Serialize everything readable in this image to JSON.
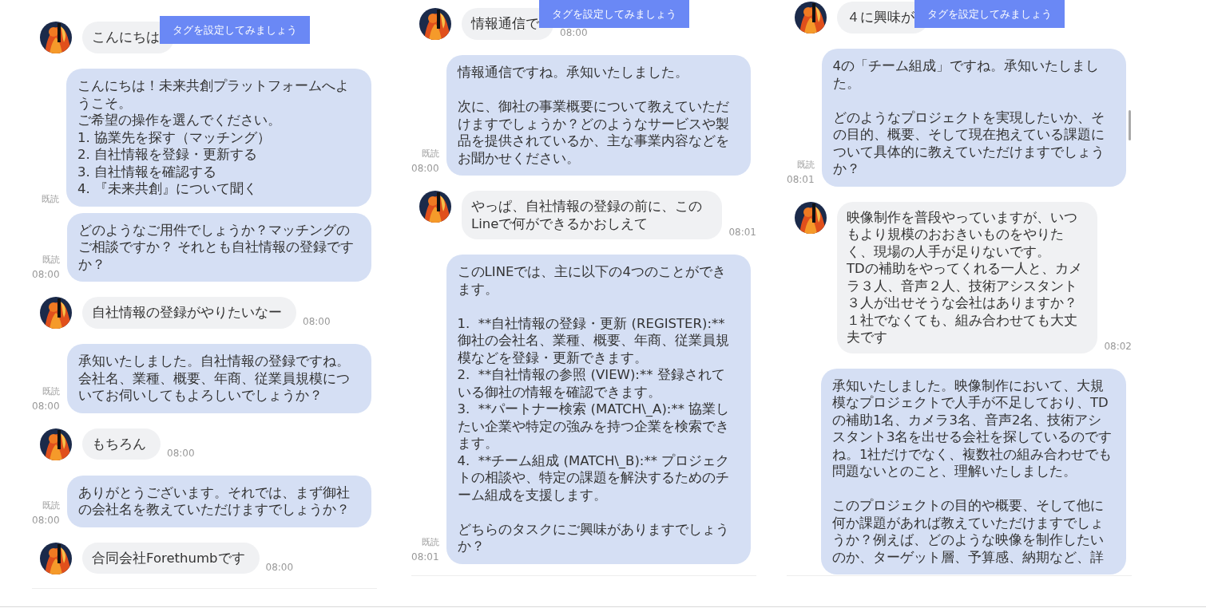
{
  "panels": [
    {
      "tag_banner": "タグを設定してみましょう",
      "scrollbar": false,
      "messages": [
        {
          "kind": "user",
          "paragraphs": [
            [
              "こんにちは"
            ]
          ]
        },
        {
          "kind": "bot",
          "paragraphs": [
            [
              "こんにちは！未来共創プラットフォームへようこそ。",
              "ご希望の操作を選んでください。",
              "1. 協業先を探す（マッチング）",
              "2. 自社情報を登録・更新する",
              "3. 自社情報を確認する",
              "4. 『未来共創』について聞く"
            ]
          ],
          "status": "既読"
        },
        {
          "kind": "bot",
          "paragraphs": [
            [
              "どのようなご用件でしょうか？マッチングのご相談ですか？ それとも自社情報の登録ですか？"
            ]
          ],
          "status": "既読",
          "time": "08:00"
        },
        {
          "kind": "user",
          "paragraphs": [
            [
              "自社情報の登録がやりたいなー"
            ]
          ],
          "time": "08:00"
        },
        {
          "kind": "bot",
          "paragraphs": [
            [
              "承知いたしました。自社情報の登録ですね。会社名、業種、概要、年商、従業員規模についてお伺いしてもよろしいでしょうか？"
            ]
          ],
          "status": "既読",
          "time": "08:00"
        },
        {
          "kind": "user",
          "paragraphs": [
            [
              "もちろん"
            ]
          ],
          "time": "08:00"
        },
        {
          "kind": "bot",
          "paragraphs": [
            [
              "ありがとうございます。それでは、まず御社の会社名を教えていただけますでしょうか？"
            ]
          ],
          "status": "既読",
          "time": "08:00"
        },
        {
          "kind": "user",
          "paragraphs": [
            [
              "合同会社Forethumbです"
            ]
          ],
          "time": "08:00"
        }
      ]
    },
    {
      "tag_banner": "タグを設定してみましょう",
      "scrollbar": false,
      "messages": [
        {
          "kind": "user",
          "paragraphs": [
            [
              "情報通信で"
            ]
          ],
          "time": "08:00"
        },
        {
          "kind": "bot",
          "paragraphs": [
            [
              "情報通信ですね。承知いたしました。"
            ],
            [
              "次に、御社の事業概要について教えていただけますでしょうか？どのようなサービスや製品を提供されているか、主な事業内容などをお聞かせください。"
            ]
          ],
          "status": "既読",
          "time": "08:00"
        },
        {
          "kind": "user",
          "paragraphs": [
            [
              "やっぱ、自社情報の登録の前に、このLineで何ができるかおしえて"
            ]
          ],
          "time": "08:01"
        },
        {
          "kind": "bot",
          "paragraphs": [
            [
              "このLINEでは、主に以下の4つのことができます。"
            ],
            [
              "1.  **自社情報の登録・更新 (REGISTER):** 御社の会社名、業種、概要、年商、従業員規模などを登録・更新できます。",
              "2.  **自社情報の参照 (VIEW):** 登録されている御社の情報を確認できます。",
              "3.  **パートナー検索 (MATCH\\_A):** 協業したい企業や特定の強みを持つ企業を検索できます。",
              "4.  **チーム組成 (MATCH\\_B):** プロジェクトの相談や、特定の課題を解決するためのチーム組成を支援します。"
            ],
            [
              "どちらのタスクにご興味がありますでしょうか？"
            ]
          ],
          "status": "既読",
          "time": "08:01"
        }
      ]
    },
    {
      "tag_banner": "タグを設定してみましょう",
      "scrollbar": true,
      "messages": [
        {
          "kind": "user",
          "paragraphs": [
            [
              "４に興味が"
            ]
          ]
        },
        {
          "kind": "bot",
          "paragraphs": [
            [
              "4の「チーム組成」ですね。承知いたしました。"
            ],
            [
              "どのようなプロジェクトを実現したいか、その目的、概要、そして現在抱えている課題について具体的に教えていただけますでしょうか？"
            ]
          ],
          "status": "既読",
          "time": "08:01"
        },
        {
          "kind": "user",
          "paragraphs": [
            [
              "映像制作を普段やっていますが、いつもより規模のおおきいものをやりたく、現場の人手が足りないです。",
              "TDの補助をやってくれる一人と、カメラ３人、音声２人、技術アシスタント３人が出せそうな会社はありますか？",
              "１社でなくても、組み合わせても大丈夫です"
            ]
          ],
          "time": "08:02"
        },
        {
          "kind": "bot",
          "paragraphs": [
            [
              "承知いたしました。映像制作において、大規模なプロジェクトで人手が不足しており、TDの補助1名、カメラ3名、音声2名、技術アシスタント3名を出せる会社を探しているのですね。1社だけでなく、複数社の組み合わせでも問題ないとのこと、理解いたしました。"
            ],
            [
              "このプロジェクトの目的や概要、そして他に何か課題があれば教えていただけますでしょうか？例えば、どのような映像を制作したいのか、ターゲット層、予算感、納期など、詳"
            ]
          ]
        }
      ]
    }
  ]
}
